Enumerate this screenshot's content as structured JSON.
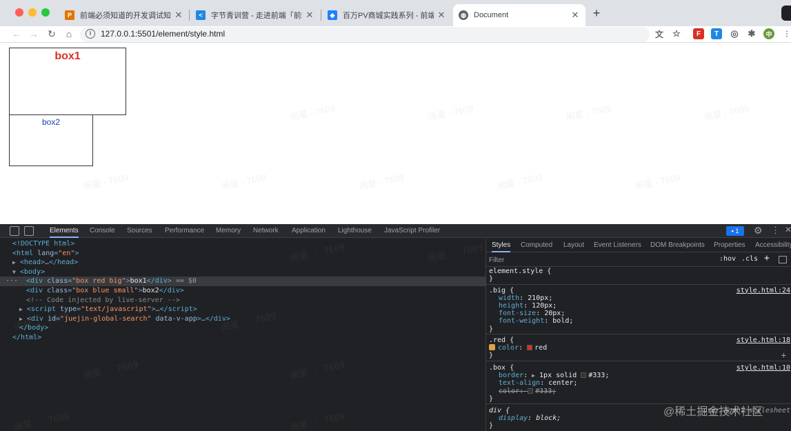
{
  "browser": {
    "tabs": [
      {
        "title": "前端必须知道的开发调试知识.ppt",
        "favicon_color": "#e37400"
      },
      {
        "title": "字节青训营 - 走进前端「前端必…",
        "favicon_color": "#1e88e5"
      },
      {
        "title": "百万PV商城实践系列 - 前端长列…",
        "favicon_color": "#1e80ff"
      },
      {
        "title": "Document",
        "favicon_color": "#5f6368",
        "active": true
      }
    ],
    "url": "127.0.0.1:5501/element/style.html"
  },
  "page": {
    "box1_text": "box1",
    "box2_text": "box2",
    "watermark_text": "闹星 - 7609"
  },
  "devtools": {
    "tabs": [
      "Elements",
      "Console",
      "Sources",
      "Performance",
      "Memory",
      "Network",
      "Application",
      "Lighthouse",
      "JavaScript Profiler"
    ],
    "active_tab": "Elements",
    "issues_count": "1",
    "dom": {
      "doctype": "<!DOCTYPE html>",
      "html_open_tag": "html",
      "html_lang_attr": "lang",
      "html_lang_val": "\"en\"",
      "head": "head",
      "head_ellipsis": "…",
      "body": "body",
      "div1_class": "\"box red big\"",
      "div1_text": "box1",
      "div1_suffix": "== $0",
      "div2_class": "\"box blue small\"",
      "div2_text": "box2",
      "comment": "<!-- Code injected by live-server -->",
      "script_type": "\"text/javascript\"",
      "div3_id": "\"juejin-global-search\"",
      "div3_extra_attr": "data-v-app"
    },
    "styles_tabs": [
      "Styles",
      "Computed",
      "Layout",
      "Event Listeners",
      "DOM Breakpoints",
      "Properties",
      "Accessibility"
    ],
    "filter_placeholder": "Filter",
    "hov": ":hov",
    "cls": ".cls",
    "rules": {
      "element_style": "element.style {",
      "big": {
        "selector": ".big {",
        "source": "style.html:24",
        "decls": [
          {
            "prop": "width",
            "val": "210px;"
          },
          {
            "prop": "height",
            "val": "120px;"
          },
          {
            "prop": "font-size",
            "val": "20px;"
          },
          {
            "prop": "font-weight",
            "val": "bold;"
          }
        ]
      },
      "red": {
        "selector": ".red {",
        "source": "style.html:18",
        "prop": "color",
        "val": "red"
      },
      "box": {
        "selector": ".box {",
        "source": "style.html:10",
        "border_prop": "border",
        "border_val": "1px solid",
        "border_color": "#333;",
        "align_prop": "text-align",
        "align_val": "center;",
        "color_prop": "color",
        "color_val": "#333;"
      },
      "div": {
        "selector": "div {",
        "source": "user agent stylesheet",
        "prop": "display",
        "val": "block;"
      },
      "close_brace": "}"
    }
  },
  "site_watermark": "@稀土掘金技术社区",
  "colors": {
    "red_swatch": "#d93025",
    "gray_swatch": "#333333"
  }
}
